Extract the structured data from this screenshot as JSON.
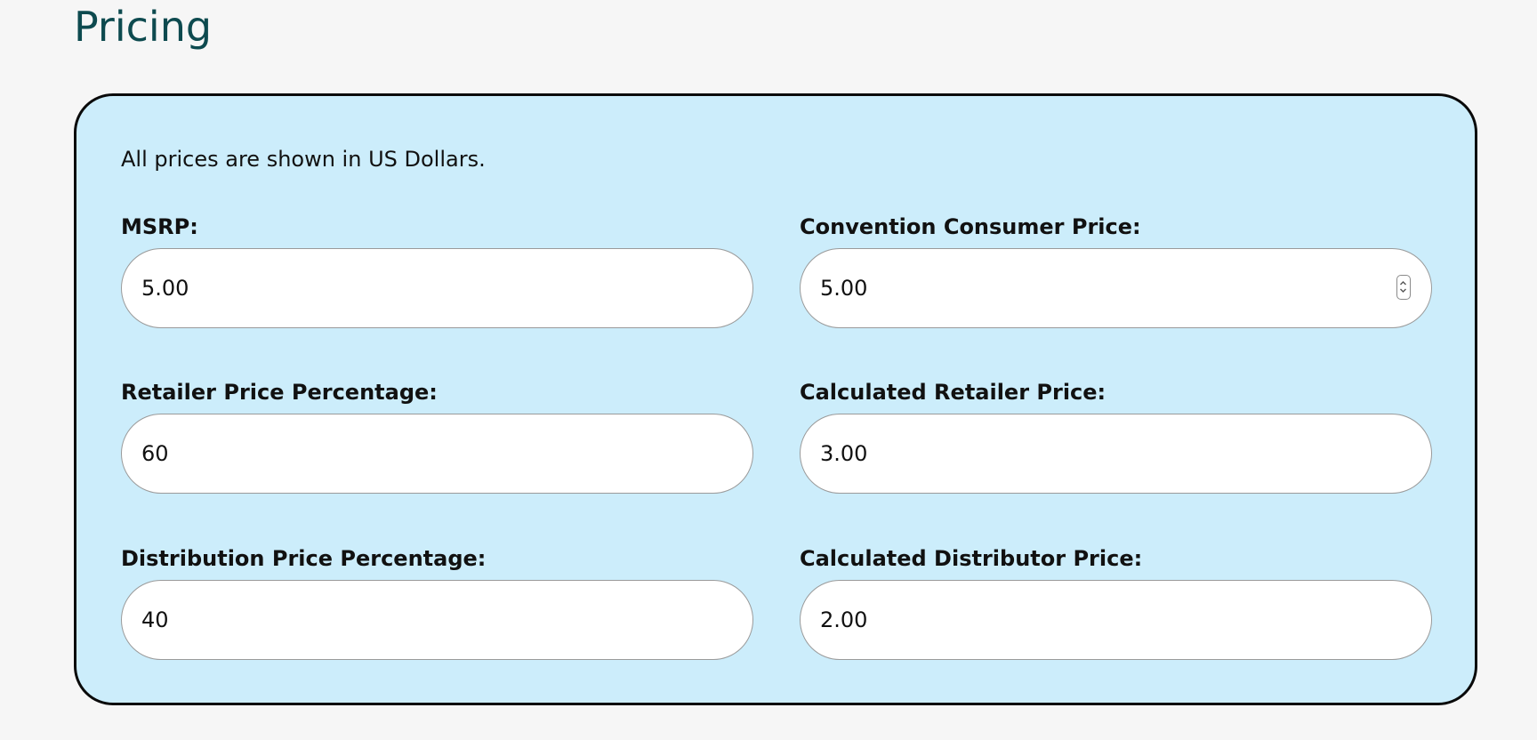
{
  "page": {
    "title": "Pricing"
  },
  "pricing": {
    "intro_text": "All prices are shown in US Dollars.",
    "fields": {
      "msrp": {
        "label": "MSRP:",
        "value": "5.00"
      },
      "convention_consumer_price": {
        "label": "Convention Consumer Price:",
        "value": "5.00",
        "icon": "spinner-arrows-icon"
      },
      "retailer_price_percentage": {
        "label": "Retailer Price Percentage:",
        "value": "60"
      },
      "calculated_retailer_price": {
        "label": "Calculated Retailer Price:",
        "value": "3.00"
      },
      "distribution_price_percentage": {
        "label": "Distribution Price Percentage:",
        "value": "40"
      },
      "calculated_distributor_price": {
        "label": "Calculated Distributor Price:",
        "value": "2.00"
      }
    }
  },
  "colors": {
    "title": "#0d4a4f",
    "panel_background": "#ccedfb",
    "panel_border": "#0a0a0a",
    "page_background": "#f6f6f6"
  }
}
